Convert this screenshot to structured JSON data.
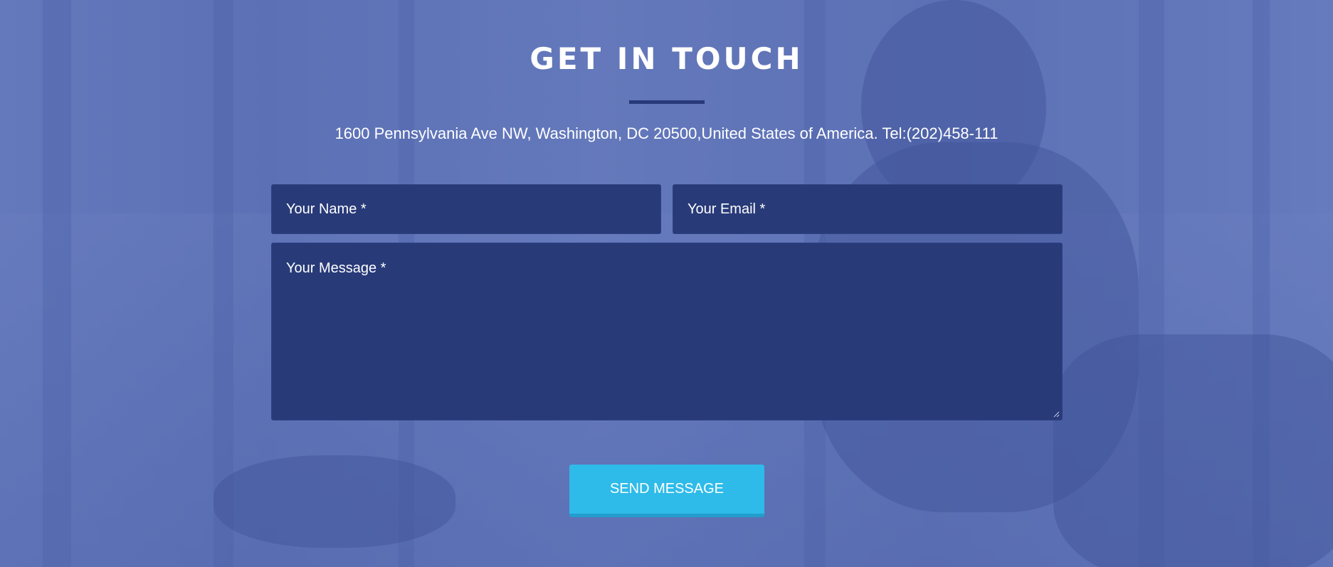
{
  "section": {
    "title": "GET IN TOUCH",
    "address": "1600 Pennsylvania Ave NW, Washington, DC 20500,United States of America. Tel:(202)458-111"
  },
  "form": {
    "name_placeholder": "Your Name *",
    "email_placeholder": "Your Email *",
    "message_placeholder": "Your Message *",
    "submit_label": "SEND MESSAGE"
  },
  "colors": {
    "background_tint": "#6176b6",
    "field_background": "#283a78",
    "divider": "#27397a",
    "button": "#2ebbe9",
    "button_border": "#239dcc",
    "text": "#ffffff"
  },
  "icons": {
    "resize": "resize-handle-icon"
  }
}
